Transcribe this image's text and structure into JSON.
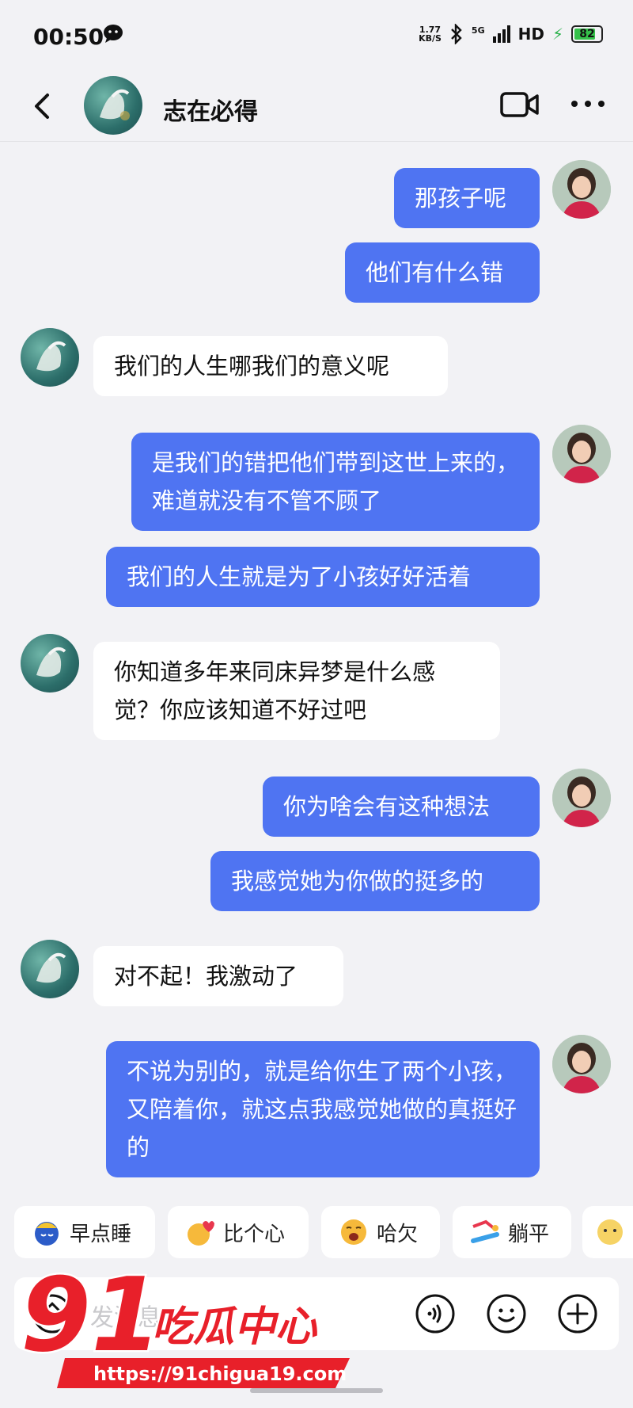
{
  "status_bar": {
    "time": "00:50",
    "net_speed_value": "1.77",
    "net_speed_unit": "KB/S",
    "signal": "5G",
    "hd": "HD",
    "battery": "82",
    "battery_level": 0.82
  },
  "header": {
    "contact_name": "志在必得"
  },
  "messages": [
    {
      "side": "out",
      "text": "那孩子呢"
    },
    {
      "side": "out",
      "text": "他们有什么错"
    },
    {
      "side": "in",
      "text": "我们的人生哪我们的意义呢"
    },
    {
      "side": "out",
      "text": "是我们的错把他们带到这世上来的，难道就没有不管不顾了"
    },
    {
      "side": "out",
      "text": "我们的人生就是为了小孩好好活着"
    },
    {
      "side": "in",
      "text": "你知道多年来同床异梦是什么感觉？你应该知道不好过吧"
    },
    {
      "side": "out",
      "text": "你为啥会有这种想法"
    },
    {
      "side": "out",
      "text": "我感觉她为你做的挺多的"
    },
    {
      "side": "in",
      "text": "对不起！我激动了"
    },
    {
      "side": "out",
      "text": "不说为别的，就是给你生了两个小孩，又陪着你，就这点我感觉她做的真挺好的"
    }
  ],
  "quick_replies": [
    {
      "label": "早点睡",
      "icon": "sleepy-face-icon"
    },
    {
      "label": "比个心",
      "icon": "heart-hands-icon"
    },
    {
      "label": "哈欠",
      "icon": "yawn-face-icon"
    },
    {
      "label": "躺平",
      "icon": "lying-flat-icon"
    }
  ],
  "input": {
    "placeholder": "发消息"
  },
  "watermark": {
    "logo_number": "91",
    "logo_text": "吃瓜中心",
    "url": "https://91chigua19.com"
  },
  "colors": {
    "outgoing_bubble": "#4f74f2",
    "incoming_bubble": "#ffffff",
    "background": "#f2f2f5",
    "watermark_red": "#e8202a"
  }
}
